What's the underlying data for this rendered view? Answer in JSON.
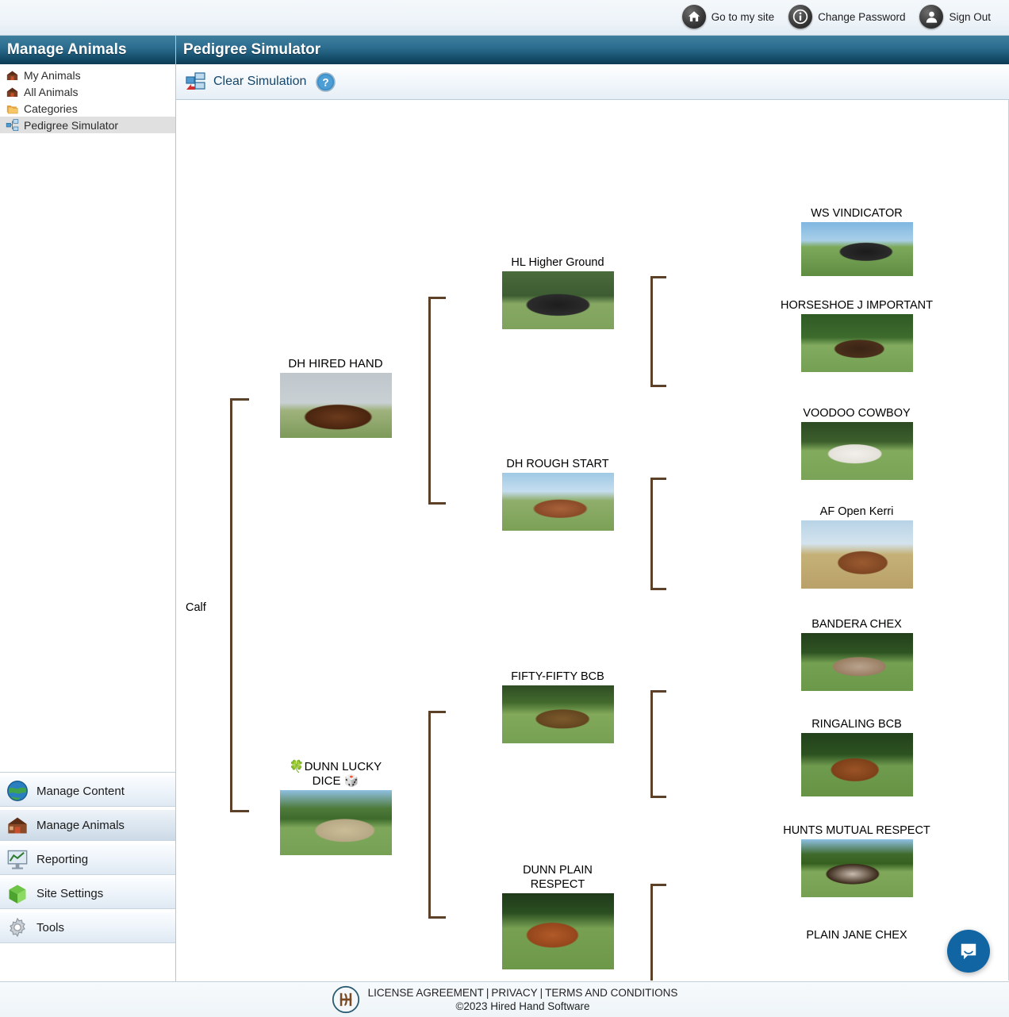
{
  "topbar": {
    "links": [
      {
        "label": "Go to my site",
        "icon": "home-icon"
      },
      {
        "label": "Change Password",
        "icon": "info-icon"
      },
      {
        "label": "Sign Out",
        "icon": "user-icon"
      }
    ]
  },
  "sidebar": {
    "title": "Manage Animals",
    "items": [
      {
        "label": "My Animals",
        "icon": "barn-icon",
        "active": false
      },
      {
        "label": "All Animals",
        "icon": "barn-icon",
        "active": false
      },
      {
        "label": "Categories",
        "icon": "folders-icon",
        "active": false
      },
      {
        "label": "Pedigree Simulator",
        "icon": "pedigree-icon",
        "active": true
      }
    ],
    "modules": [
      {
        "label": "Manage Content",
        "icon": "globe-icon",
        "active": false
      },
      {
        "label": "Manage Animals",
        "icon": "barn-icon",
        "active": true
      },
      {
        "label": "Reporting",
        "icon": "chart-icon",
        "active": false
      },
      {
        "label": "Site Settings",
        "icon": "box-icon",
        "active": false
      },
      {
        "label": "Tools",
        "icon": "gear-icon",
        "active": false
      }
    ]
  },
  "main": {
    "title": "Pedigree Simulator",
    "toolbar": {
      "clear_label": "Clear Simulation",
      "clear_icon": "clear-simulation-icon",
      "help_icon": "help-icon"
    }
  },
  "pedigree": {
    "root_label": "Calf",
    "sire": {
      "label": "DH HIRED HAND",
      "sire": {
        "label": "HL Higher Ground",
        "sire": {
          "label": "WS VINDICATOR",
          "has_photo": true
        },
        "dam": {
          "label": "HORSESHOE J IMPORTANT",
          "has_photo": true
        }
      },
      "dam": {
        "label": "DH ROUGH START",
        "sire": {
          "label": "VOODOO COWBOY",
          "has_photo": true
        },
        "dam": {
          "label": "AF Open Kerri",
          "has_photo": true
        }
      }
    },
    "dam": {
      "label": "🍀DUNN LUCKY DICE 🎲",
      "sire": {
        "label": "FIFTY-FIFTY BCB",
        "sire": {
          "label": "BANDERA CHEX",
          "has_photo": true
        },
        "dam": {
          "label": "RINGALING BCB",
          "has_photo": true
        }
      },
      "dam": {
        "label": "DUNN PLAIN RESPECT",
        "sire": {
          "label": "HUNTS MUTUAL RESPECT",
          "has_photo": true
        },
        "dam": {
          "label": "PLAIN JANE CHEX",
          "has_photo": false
        }
      }
    }
  },
  "footer": {
    "license": "LICENSE AGREEMENT",
    "privacy": "PRIVACY",
    "terms": "TERMS AND CONDITIONS",
    "copyright": "©2023 Hired Hand Software",
    "logo": "hired-hand-logo"
  },
  "chat": {
    "icon": "chat-bubble-icon"
  },
  "colors": {
    "header_blue": "#17506d",
    "bracket_brown": "#5c4028",
    "chat_blue": "#1165a3",
    "active_row": "#e0e0e0"
  }
}
